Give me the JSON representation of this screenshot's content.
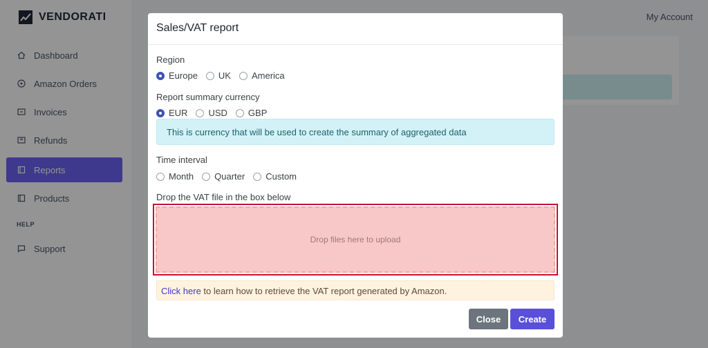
{
  "app": {
    "brand": "VENDORATI",
    "account_label": "My Account"
  },
  "sidebar": {
    "items": [
      {
        "label": "Dashboard",
        "icon": "home-icon"
      },
      {
        "label": "Amazon Orders",
        "icon": "dollar-circle-icon"
      },
      {
        "label": "Invoices",
        "icon": "invoice-icon"
      },
      {
        "label": "Refunds",
        "icon": "refund-icon"
      },
      {
        "label": "Reports",
        "icon": "reports-icon",
        "active": true
      },
      {
        "label": "Products",
        "icon": "products-icon"
      }
    ],
    "help_section": "HELP",
    "help_items": [
      {
        "label": "Support",
        "icon": "chat-icon"
      }
    ]
  },
  "modal": {
    "title": "Sales/VAT report",
    "region": {
      "label": "Region",
      "options": [
        "Europe",
        "UK",
        "America"
      ],
      "selected": "Europe"
    },
    "currency": {
      "label": "Report summary currency",
      "options": [
        "EUR",
        "USD",
        "GBP"
      ],
      "selected": "EUR",
      "info": "This is currency that will be used to create the summary of aggregated data"
    },
    "interval": {
      "label": "Time interval",
      "options": [
        "Month",
        "Quarter",
        "Custom"
      ],
      "selected": null
    },
    "dropzone": {
      "label": "Drop the VAT file in the box below",
      "placeholder": "Drop files here to upload"
    },
    "help_note": {
      "link": "Click here",
      "text": " to learn how to retrieve the VAT report generated by Amazon."
    },
    "buttons": {
      "close": "Close",
      "create": "Create"
    }
  },
  "colors": {
    "accent": "#5a4fd8",
    "sidebar_active": "#6b62f2",
    "radio_checked": "#3f51b5",
    "dropzone_border": "#c8102e"
  }
}
